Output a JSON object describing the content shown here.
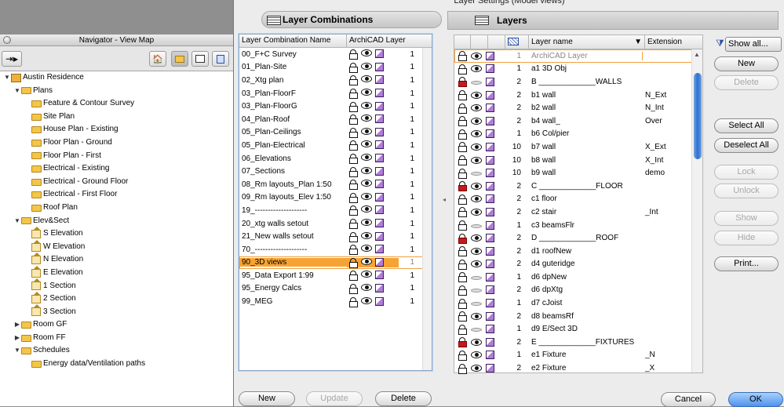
{
  "navigator": {
    "title": "Navigator - View Map",
    "tree": [
      {
        "label": "Austin Residence",
        "level": 0,
        "kind": "house",
        "expanded": true
      },
      {
        "label": "Plans",
        "level": 1,
        "kind": "folder",
        "expanded": true
      },
      {
        "label": "Feature & Contour Survey",
        "level": 2,
        "kind": "folder"
      },
      {
        "label": "Site Plan",
        "level": 2,
        "kind": "folder"
      },
      {
        "label": "House Plan - Existing",
        "level": 2,
        "kind": "folder"
      },
      {
        "label": "Floor Plan - Ground",
        "level": 2,
        "kind": "folder"
      },
      {
        "label": "Floor Plan - First",
        "level": 2,
        "kind": "folder"
      },
      {
        "label": "Electrical - Existing",
        "level": 2,
        "kind": "folder"
      },
      {
        "label": "Electrical - Ground Floor",
        "level": 2,
        "kind": "folder"
      },
      {
        "label": "Electrical - First Floor",
        "level": 2,
        "kind": "folder"
      },
      {
        "label": "Roof Plan",
        "level": 2,
        "kind": "folder"
      },
      {
        "label": "Elev&Sect",
        "level": 1,
        "kind": "folder",
        "expanded": true
      },
      {
        "label": "S Elevation",
        "level": 2,
        "kind": "view"
      },
      {
        "label": "W Elevation",
        "level": 2,
        "kind": "view"
      },
      {
        "label": "N Elevation",
        "level": 2,
        "kind": "view"
      },
      {
        "label": "E Elevation",
        "level": 2,
        "kind": "view"
      },
      {
        "label": "1 Section",
        "level": 2,
        "kind": "view"
      },
      {
        "label": "2 Section",
        "level": 2,
        "kind": "view"
      },
      {
        "label": "3 Section",
        "level": 2,
        "kind": "view"
      },
      {
        "label": "Room GF",
        "level": 1,
        "kind": "folder",
        "collapsed": true
      },
      {
        "label": "Room FF",
        "level": 1,
        "kind": "folder",
        "collapsed": true
      },
      {
        "label": "Schedules",
        "level": 1,
        "kind": "folder",
        "expanded": true
      },
      {
        "label": "Energy data/Ventilation paths",
        "level": 2,
        "kind": "folder"
      }
    ]
  },
  "dialog": {
    "title": "Layer Settings (Model views)",
    "combinations_header": "Layer Combinations",
    "layers_header": "Layers",
    "combo_columns": [
      "Layer Combination Name",
      "ArchiCAD Layer"
    ],
    "combinations": [
      {
        "name": "00_F+C Survey",
        "count": "1"
      },
      {
        "name": "01_Plan-Site",
        "count": "1"
      },
      {
        "name": "02_Xtg plan",
        "count": "1"
      },
      {
        "name": "03_Plan-FloorF",
        "count": "1"
      },
      {
        "name": "03_Plan-FloorG",
        "count": "1"
      },
      {
        "name": "04_Plan-Roof",
        "count": "1"
      },
      {
        "name": "05_Plan-Ceilings",
        "count": "1"
      },
      {
        "name": "05_Plan-Electrical",
        "count": "1"
      },
      {
        "name": "06_Elevations",
        "count": "1"
      },
      {
        "name": "07_Sections",
        "count": "1"
      },
      {
        "name": "08_Rm layouts_Plan 1:50",
        "count": "1"
      },
      {
        "name": "09_Rm layouts_Elev 1:50",
        "count": "1"
      },
      {
        "name": "19_--------------------",
        "count": "1"
      },
      {
        "name": "20_xtg walls setout",
        "count": "1"
      },
      {
        "name": "21_New walls setout",
        "count": "1"
      },
      {
        "name": "70_--------------------",
        "count": "1"
      },
      {
        "name": "90_3D views",
        "count": "1",
        "selected": true
      },
      {
        "name": "95_Data Export 1:99",
        "count": "1"
      },
      {
        "name": "95_Energy Calcs",
        "count": "1"
      },
      {
        "name": "99_MEG",
        "count": "1"
      }
    ],
    "combo_buttons": {
      "new": "New",
      "update": "Update",
      "delete": "Delete"
    },
    "layer_columns": [
      "Layer name",
      "Extension"
    ],
    "layers": [
      {
        "num": "1",
        "name": "ArchiCAD Layer",
        "ext": "",
        "lock": false,
        "visible": true,
        "first": true
      },
      {
        "num": "1",
        "name": "a1 3D Obj",
        "ext": "",
        "lock": false,
        "visible": true
      },
      {
        "num": "2",
        "name": "B _____________WALLS",
        "ext": "",
        "lock": true,
        "visible": false
      },
      {
        "num": "2",
        "name": "b1 wall",
        "ext": "N_Ext",
        "lock": false,
        "visible": true
      },
      {
        "num": "2",
        "name": "b2 wall",
        "ext": "N_Int",
        "lock": false,
        "visible": true
      },
      {
        "num": "2",
        "name": "b4 wall_",
        "ext": "Over",
        "lock": false,
        "visible": true
      },
      {
        "num": "1",
        "name": "b6 Col/pier",
        "ext": "",
        "lock": false,
        "visible": true
      },
      {
        "num": "10",
        "name": "b7 wall",
        "ext": "X_Ext",
        "lock": false,
        "visible": true
      },
      {
        "num": "10",
        "name": "b8 wall",
        "ext": "X_Int",
        "lock": false,
        "visible": true
      },
      {
        "num": "10",
        "name": "b9 wall",
        "ext": "demo",
        "lock": false,
        "visible": false
      },
      {
        "num": "2",
        "name": "C _____________FLOOR",
        "ext": "",
        "lock": true,
        "visible": true
      },
      {
        "num": "2",
        "name": "c1 floor",
        "ext": "",
        "lock": false,
        "visible": true
      },
      {
        "num": "2",
        "name": "c2 stair",
        "ext": "_Int",
        "lock": false,
        "visible": true
      },
      {
        "num": "1",
        "name": "c3 beamsFlr",
        "ext": "",
        "lock": false,
        "visible": false
      },
      {
        "num": "2",
        "name": "D _____________ROOF",
        "ext": "",
        "lock": true,
        "visible": true
      },
      {
        "num": "2",
        "name": "d1 roofNew",
        "ext": "",
        "lock": false,
        "visible": true
      },
      {
        "num": "2",
        "name": "d4 guteridge",
        "ext": "",
        "lock": false,
        "visible": true
      },
      {
        "num": "1",
        "name": "d6 dpNew",
        "ext": "",
        "lock": false,
        "visible": false
      },
      {
        "num": "2",
        "name": "d6 dpXtg",
        "ext": "",
        "lock": false,
        "visible": false
      },
      {
        "num": "1",
        "name": "d7 cJoist",
        "ext": "",
        "lock": false,
        "visible": false
      },
      {
        "num": "2",
        "name": "d8 beamsRf",
        "ext": "",
        "lock": false,
        "visible": true
      },
      {
        "num": "1",
        "name": "d9 E/Sect 3D",
        "ext": "",
        "lock": false,
        "visible": false
      },
      {
        "num": "2",
        "name": "E _____________FIXTURES",
        "ext": "",
        "lock": true,
        "visible": true
      },
      {
        "num": "1",
        "name": "e1 Fixture",
        "ext": "_N",
        "lock": false,
        "visible": true
      },
      {
        "num": "2",
        "name": "e2 Fixture",
        "ext": "_X",
        "lock": false,
        "visible": true
      }
    ],
    "side_buttons": {
      "show_all": "Show all...",
      "new": "New",
      "delete": "Delete",
      "select_all": "Select All",
      "deselect_all": "Deselect All",
      "lock": "Lock",
      "unlock": "Unlock",
      "show": "Show",
      "hide": "Hide",
      "print": "Print..."
    },
    "cancel": "Cancel",
    "ok": "OK"
  }
}
